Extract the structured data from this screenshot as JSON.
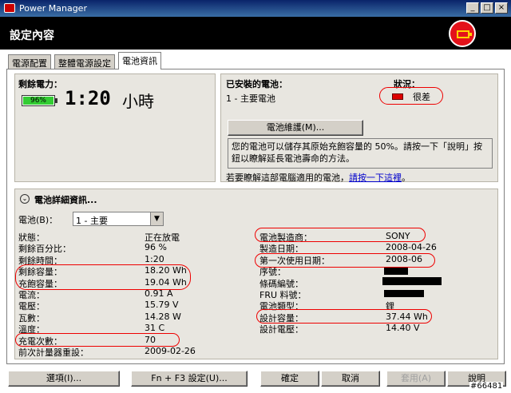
{
  "window": {
    "title": "Power Manager"
  },
  "header": {
    "title": "設定內容"
  },
  "tabs": [
    {
      "label": "電源配置"
    },
    {
      "label": "整體電源設定"
    },
    {
      "label": "電池資訊"
    }
  ],
  "remaining": {
    "label": "剩餘電力：",
    "percent": "96%",
    "time": "1:20",
    "time_unit": "小時"
  },
  "installed": {
    "label": "已安裝的電池：",
    "battery": "1 - 主要電池",
    "status_label": "狀況：",
    "status_value": "很差",
    "maintenance_button": "電池維護(M)...",
    "message": "您的電池可以儲存其原始充飽容量的 50%。請按一下「說明」按鈕以瞭解延長電池壽命的方法。",
    "learn_text": "若要瞭解這部電腦適用的電池，",
    "learn_link": "請按一下這裡",
    "learn_end": "。"
  },
  "details": {
    "title": "電池詳細資訊...",
    "battery_label": "電池(B)：",
    "battery_select": "1 - 主要",
    "left": [
      {
        "label": "狀態：",
        "value": "正在放電"
      },
      {
        "label": "剩餘百分比：",
        "value": "96 %"
      },
      {
        "label": "剩餘時間：",
        "value": "1:20"
      },
      {
        "label": "剩餘容量：",
        "value": "18.20 Wh"
      },
      {
        "label": "充飽容量：",
        "value": "19.04 Wh"
      },
      {
        "label": "電流：",
        "value": "0.91 A"
      },
      {
        "label": "電壓：",
        "value": "15.79 V"
      },
      {
        "label": "瓦數：",
        "value": "14.28 W"
      },
      {
        "label": "溫度：",
        "value": "31 C"
      },
      {
        "label": "充電次數：",
        "value": "70"
      },
      {
        "label": "前次計量器重設：",
        "value": "2009-02-26"
      }
    ],
    "right": [
      {
        "label": "電池製造商：",
        "value": "SONY"
      },
      {
        "label": "製造日期：",
        "value": "2008-04-26"
      },
      {
        "label": "第一次使用日期：",
        "value": "2008-06"
      },
      {
        "label": "序號：",
        "value": ""
      },
      {
        "label": "條碼編號：",
        "value": ""
      },
      {
        "label": "FRU 料號：",
        "value": ""
      },
      {
        "label": "電池類型：",
        "value": "鋰"
      },
      {
        "label": "設計容量：",
        "value": "37.44 Wh"
      },
      {
        "label": "設計電壓：",
        "value": "14.40 V"
      }
    ]
  },
  "buttons": {
    "options": "選項(I)...",
    "fn_f3": "Fn + F3 設定(U)...",
    "ok": "確定",
    "cancel": "取消",
    "apply": "套用(A)",
    "help": "說明"
  },
  "watermark": "#66481"
}
